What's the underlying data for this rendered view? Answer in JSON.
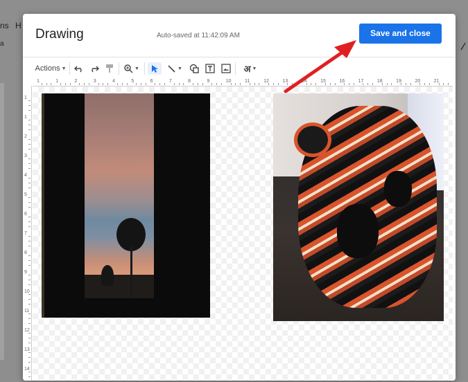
{
  "background": {
    "menu": [
      "ns",
      "H"
    ],
    "toolbar_text": "a"
  },
  "dialog": {
    "title": "Drawing",
    "autosave": "Auto-saved at 11:42:09 AM",
    "save_label": "Save and close"
  },
  "toolbar": {
    "actions_label": "Actions",
    "hindi_glyph": "अ"
  },
  "rulers": {
    "h_ticks": [
      "1",
      "1",
      "2",
      "3",
      "4",
      "5",
      "6",
      "7",
      "8",
      "9",
      "10",
      "11",
      "12",
      "13",
      "14",
      "15",
      "16",
      "17",
      "18",
      "19",
      "20",
      "21"
    ],
    "v_ticks": [
      "1",
      "1",
      "2",
      "3",
      "4",
      "5",
      "6",
      "7",
      "8",
      "9",
      "10",
      "11",
      "12",
      "13",
      "14"
    ]
  },
  "colors": {
    "primary": "#1a73e8",
    "arrow": "#e02020"
  }
}
